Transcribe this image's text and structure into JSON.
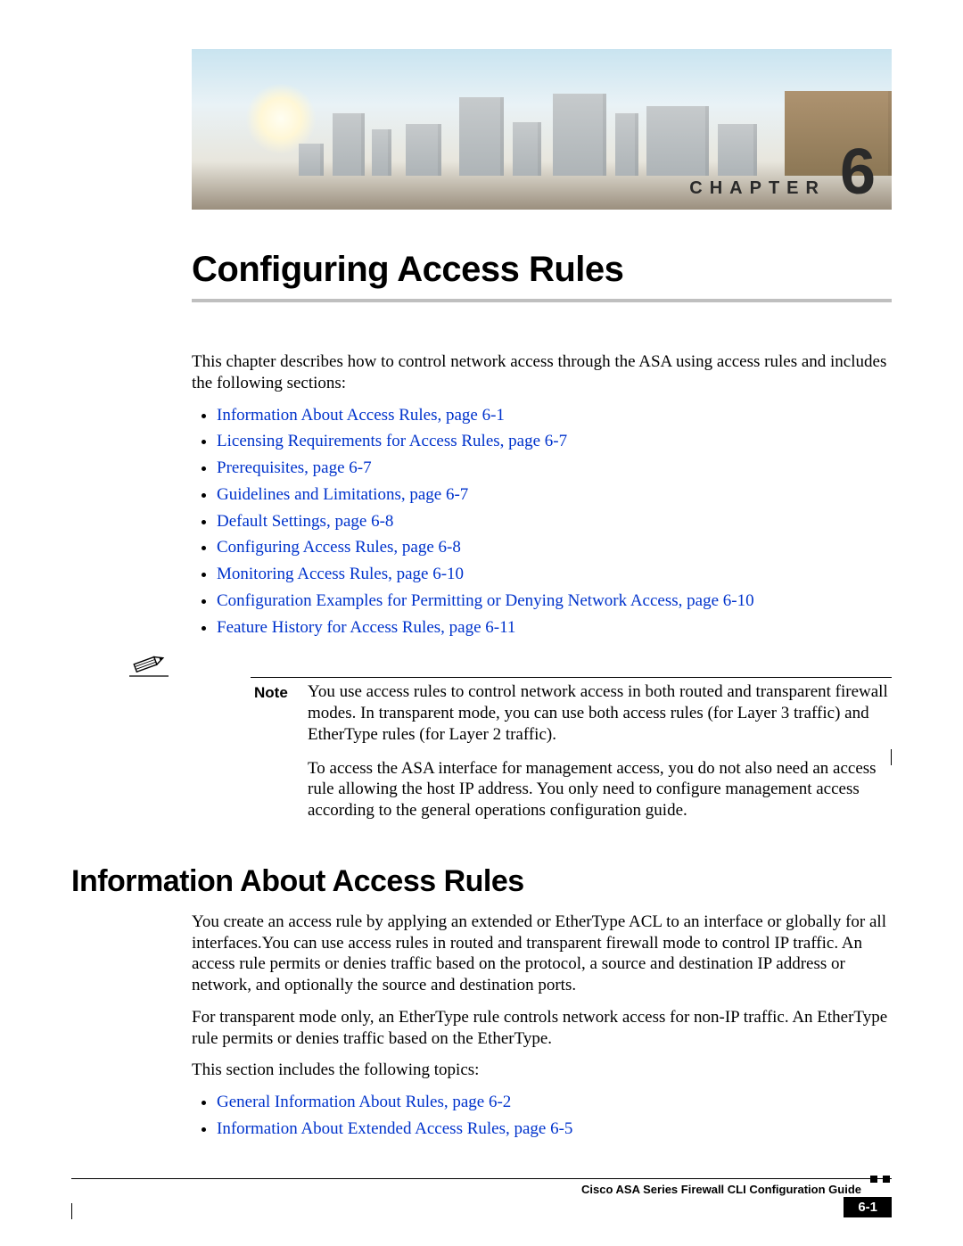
{
  "banner": {
    "chapter_label": "CHAPTER",
    "chapter_number": "6"
  },
  "title": "Configuring Access Rules",
  "intro_paragraph": "This chapter describes how to control network access through the ASA using access rules and includes the following sections:",
  "toc_links": [
    "Information About Access Rules, page 6-1",
    "Licensing Requirements for Access Rules, page 6-7",
    "Prerequisites, page 6-7",
    "Guidelines and Limitations, page 6-7",
    "Default Settings, page 6-8",
    "Configuring Access Rules, page 6-8",
    "Monitoring Access Rules, page 6-10",
    "Configuration Examples for Permitting or Denying Network Access, page 6-10",
    "Feature History for Access Rules, page 6-11"
  ],
  "note": {
    "label": "Note",
    "paragraph1": "You use access rules to control network access in both routed and transparent firewall modes. In transparent mode, you can use both access rules (for Layer 3 traffic) and EtherType rules (for Layer 2 traffic).",
    "paragraph2": "To access the ASA interface for management access, you do not also need an access rule allowing the host IP address. You only need to configure management access according to the general operations configuration guide."
  },
  "section2": {
    "heading": "Information About Access Rules",
    "paragraph1": "You create an access rule by applying an extended or EtherType ACL to an interface or globally for all interfaces.You can use access rules in routed and transparent firewall mode to control IP traffic. An access rule permits or denies traffic based on the protocol, a source and destination IP address or network, and optionally the source and destination ports.",
    "paragraph2": "For transparent mode only, an EtherType rule controls network access for non-IP traffic. An EtherType rule permits or denies traffic based on the EtherType.",
    "paragraph3": "This section includes the following topics:",
    "links": [
      "General Information About Rules, page 6-2",
      "Information About Extended Access Rules, page 6-5"
    ]
  },
  "footer": {
    "book_title": "Cisco ASA Series Firewall CLI Configuration Guide",
    "page_number": "6-1"
  }
}
